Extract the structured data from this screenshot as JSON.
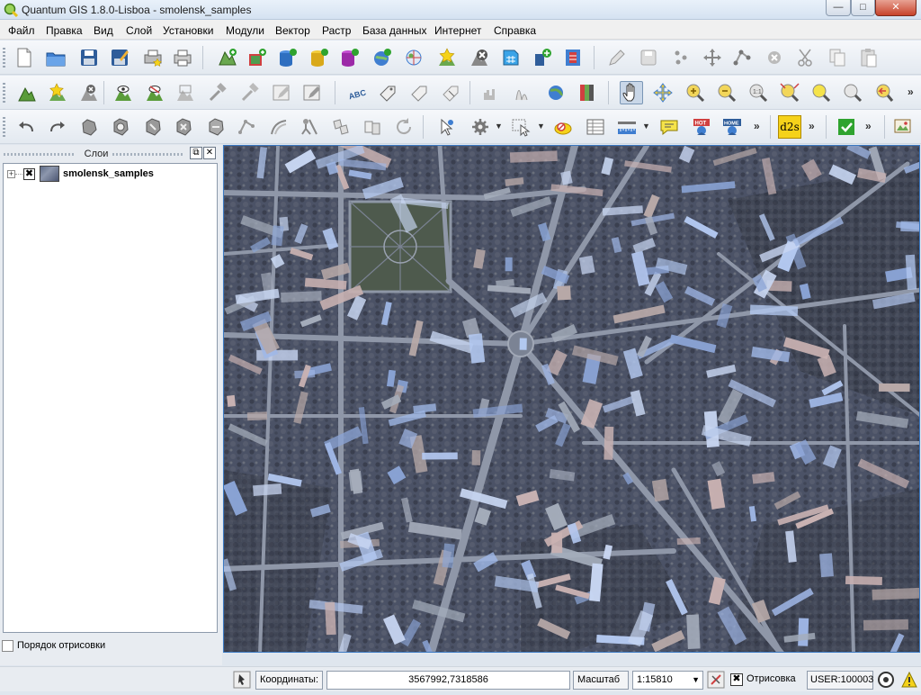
{
  "window": {
    "title": "Quantum GIS 1.8.0-Lisboa - smolensk_samples",
    "controls": {
      "minimize": "—",
      "maximize": "□",
      "close": "✕"
    }
  },
  "menubar": {
    "items": [
      "Файл",
      "Правка",
      "Вид",
      "Слой",
      "Установки",
      "Модули",
      "Вектор",
      "Растр",
      "База данных",
      "Интернет",
      "Справка"
    ]
  },
  "toolbars": {
    "overflow_glyph": "»",
    "d2s_label": "d2s",
    "abc_label": "ABC",
    "hot_label": "HOT",
    "home_label": "HOME"
  },
  "layers_panel": {
    "title": "Слои",
    "float_glyph": "⧉",
    "close_glyph": "✕",
    "layer": {
      "name": "smolensk_samples",
      "visible_glyph": "✖",
      "expander_glyph": "+"
    },
    "render_order_label": "Порядок отрисовки"
  },
  "statusbar": {
    "coordinates_label": "Координаты:",
    "coordinates_value": "3567992,7318586",
    "scale_label": "Масштаб",
    "scale_value": "1:15810",
    "render_label": "Отрисовка",
    "render_check_glyph": "✖",
    "crs": "USER:100003"
  },
  "colors": {
    "map_border": "#3b79c2",
    "map_base": "#4a5064",
    "roof_blue": "#b3c8f0"
  }
}
